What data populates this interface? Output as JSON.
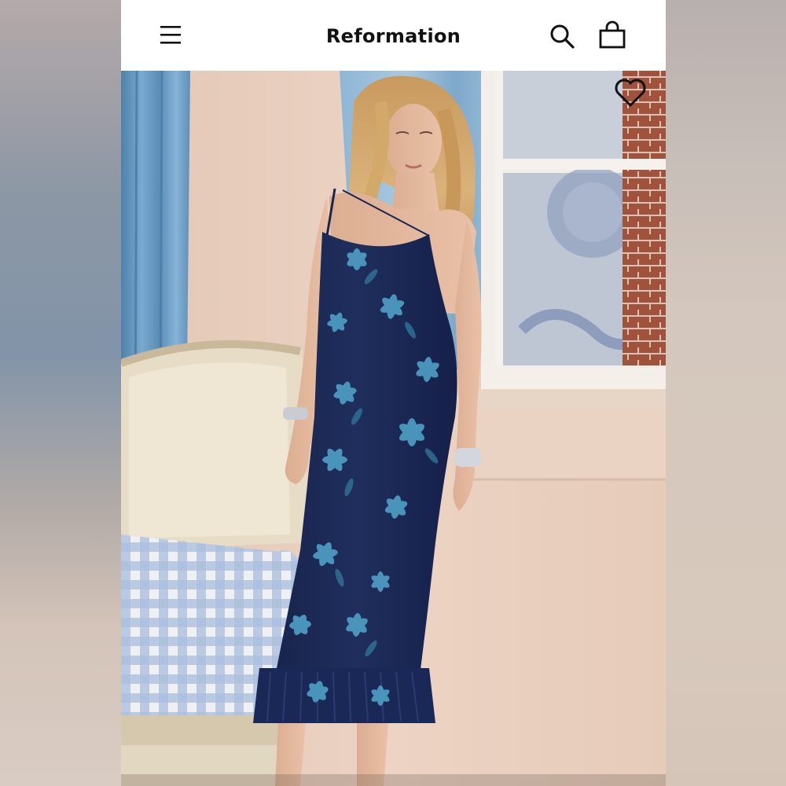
{
  "header": {
    "brand": "Reformation",
    "menu_icon": "hamburger-menu-icon",
    "search_icon": "search-icon",
    "bag_icon": "shopping-bag-icon"
  },
  "product_image": {
    "favorite_icon": "heart-outline-icon"
  },
  "colors": {
    "header_bg": "#ffffff",
    "icon_color": "#111111",
    "wall": "#e8cdbd",
    "curtain": "#6e9ec4",
    "dress": "#1c2a55",
    "dress_print": "#4f9ec4",
    "gingham": "#9fb3d6"
  }
}
